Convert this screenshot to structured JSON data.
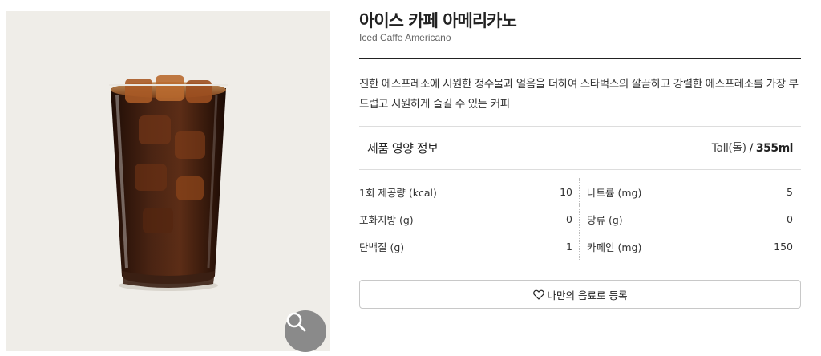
{
  "product": {
    "title_ko": "아이스 카페 아메리카노",
    "title_en": "Iced Caffe Americano",
    "description": "진한 에스프레소에 시원한 정수물과 얼음을 더하여 스타벅스의 깔끔하고 강렬한 에스프레소를 가장 부드럽고 시원하게 즐길 수 있는 커피",
    "image_icon": "iced-coffee-glass",
    "zoom_icon": "magnifier-icon"
  },
  "nutrition": {
    "title": "제품 영양 정보",
    "size_label": "Tall(톨)",
    "size_separator": "/",
    "volume": "355ml",
    "rows": [
      {
        "left_label": "1회 제공량 (kcal)",
        "left_value": "10",
        "right_label": "나트륨 (mg)",
        "right_value": "5"
      },
      {
        "left_label": "포화지방 (g)",
        "left_value": "0",
        "right_label": "당류 (g)",
        "right_value": "0"
      },
      {
        "left_label": "단백질 (g)",
        "left_value": "1",
        "right_label": "카페인 (mg)",
        "right_value": "150"
      }
    ]
  },
  "favorite": {
    "label": "나만의 음료로 등록",
    "icon": "heart-outline-icon"
  },
  "colors": {
    "image_bg": "#efede8",
    "zoom_bg": "#8a8a8a",
    "rule_dark": "#222222",
    "coffee": "#3a1d10"
  }
}
